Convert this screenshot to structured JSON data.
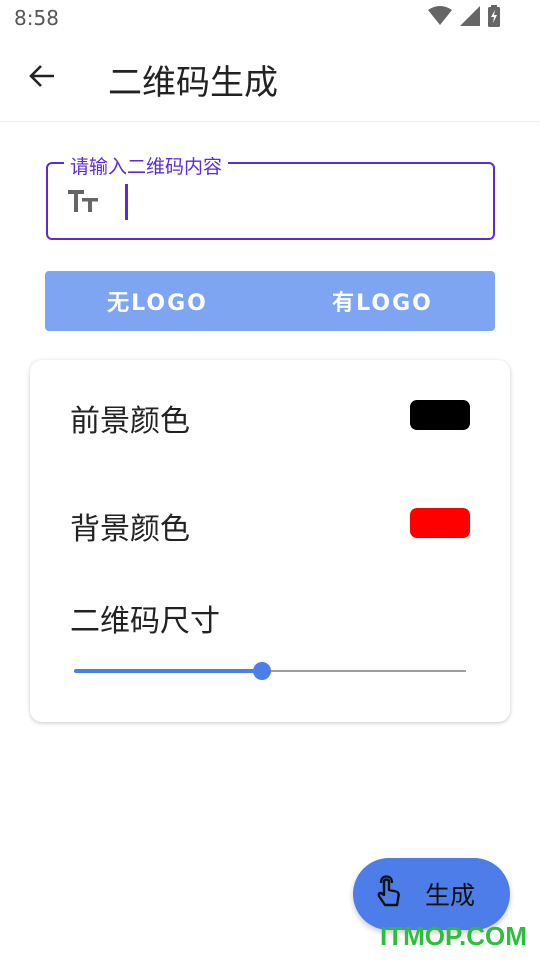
{
  "status_bar": {
    "time": "8:58"
  },
  "app_bar": {
    "title": "二维码生成"
  },
  "input": {
    "label": "请输入二维码内容",
    "value": ""
  },
  "logo_toggle": {
    "no_logo": "无LOGO",
    "with_logo": "有LOGO"
  },
  "settings": {
    "foreground_label": "前景颜色",
    "foreground_color": "#000000",
    "background_label": "背景颜色",
    "background_color": "#ff0000",
    "size_label": "二维码尺寸",
    "size_slider_value": 0.48
  },
  "fab": {
    "label": "生成"
  },
  "watermark": "ITMOP.COM",
  "colors": {
    "accent": "#4c7de8",
    "input_border": "#5b2bd8",
    "toggle_bg": "#7ea5f2"
  }
}
